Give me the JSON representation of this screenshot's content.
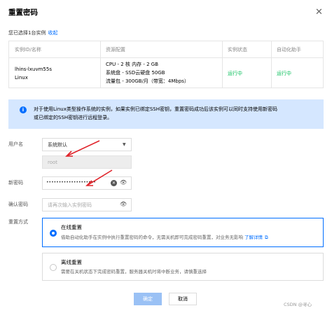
{
  "dialog": {
    "title": "重置密码",
    "close_glyph": "✕"
  },
  "selection": {
    "text": "您已选择1台实例",
    "collapse_link": "收起"
  },
  "table": {
    "headers": [
      "实例ID/名称",
      "资源配置",
      "实例状态",
      "自动化助手"
    ],
    "rows": [
      {
        "id": "lhins-lxuvm55s",
        "name": "Linux",
        "cpu_mem": "CPU - 2 核 内存 - 2 GB",
        "disk": "系统盘 - SSD云硬盘 50GB",
        "traffic": "流量包 - 300GB/月（带宽：4Mbps）",
        "status": "运行中",
        "assistant": "运行中"
      }
    ],
    "status_color": "#0abf5b"
  },
  "notice": {
    "icon": "info-icon",
    "line1": "对于使用Linux类型操作系统的实例，如果实例已绑定SSH密钥，重置密码成功后该实例可以同时支持使用新密码",
    "line2": "或已绑定的SSH密钥进行远程登录。"
  },
  "form": {
    "username_label": "用户名",
    "username_value": "系统默认",
    "root_value": "root",
    "new_password_label": "新密码",
    "new_password_value": "••••••••••••••••••••",
    "confirm_password_label": "确认密码",
    "confirm_password_placeholder": "请再次输入实例密码",
    "reset_method_label": "重置方式"
  },
  "options": {
    "online": {
      "title": "在线重置",
      "desc": "借助自动化助手在实例中执行重置密码的命令，无需关机即可完成密码重置，对业务无影响",
      "link": "了解详情"
    },
    "offline": {
      "title": "离线重置",
      "desc": "需要在关机状态下完成密码重置，服务器关机时将中断业务，请慎重选择"
    }
  },
  "buttons": {
    "confirm": "确定",
    "cancel": "取消"
  },
  "watermark": "CSDN @寻心",
  "colors": {
    "accent": "#006eff",
    "notice_bg": "#d5e7ff",
    "arrow": "#e0232a"
  }
}
